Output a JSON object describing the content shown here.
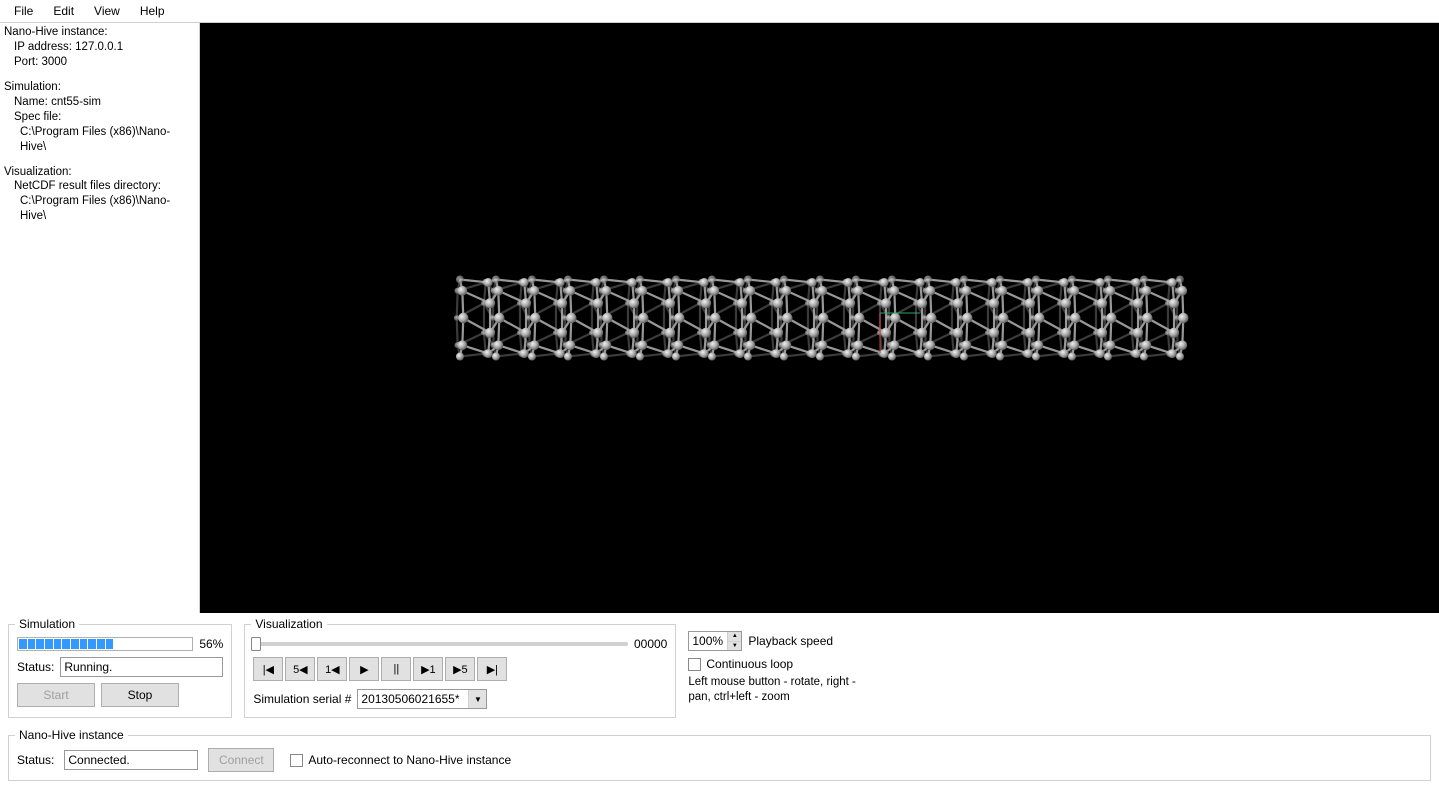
{
  "menu": {
    "file": "File",
    "edit": "Edit",
    "view": "View",
    "help": "Help"
  },
  "sidebar": {
    "instance_heading": "Nano-Hive instance:",
    "ip_label": "IP address: 127.0.0.1",
    "port_label": "Port: 3000",
    "sim_heading": "Simulation:",
    "sim_name": "Name: cnt55-sim",
    "spec_file_label": "Spec file:",
    "spec_file_path": "C:\\Program Files (x86)\\Nano-Hive\\",
    "vis_heading": "Visualization:",
    "netcdf_label": "NetCDF result files directory:",
    "netcdf_path": "C:\\Program Files (x86)\\Nano-Hive\\"
  },
  "simulation": {
    "legend": "Simulation",
    "progress_pct": "56%",
    "status_label": "Status:",
    "status_value": "Running.",
    "start": "Start",
    "stop": "Stop"
  },
  "visualization": {
    "legend": "Visualization",
    "frame_value": "00000",
    "serial_label": "Simulation serial #",
    "serial_value": "20130506021655*",
    "btn_first": "|◀",
    "btn_back5": "5◀",
    "btn_back1": "1◀",
    "btn_play": "▶",
    "btn_pause": "||",
    "btn_fwd1": "▶1",
    "btn_fwd5": "▶5",
    "btn_last": "▶|"
  },
  "playback": {
    "speed_value": "100%",
    "speed_label": "Playback speed",
    "loop_label": "Continuous loop",
    "hint": "Left mouse button - rotate, right - pan, ctrl+left - zoom"
  },
  "nanohive": {
    "legend": "Nano-Hive instance",
    "status_label": "Status:",
    "status_value": "Connected.",
    "connect": "Connect",
    "autoreconnect": "Auto-reconnect to Nano-Hive instance"
  }
}
